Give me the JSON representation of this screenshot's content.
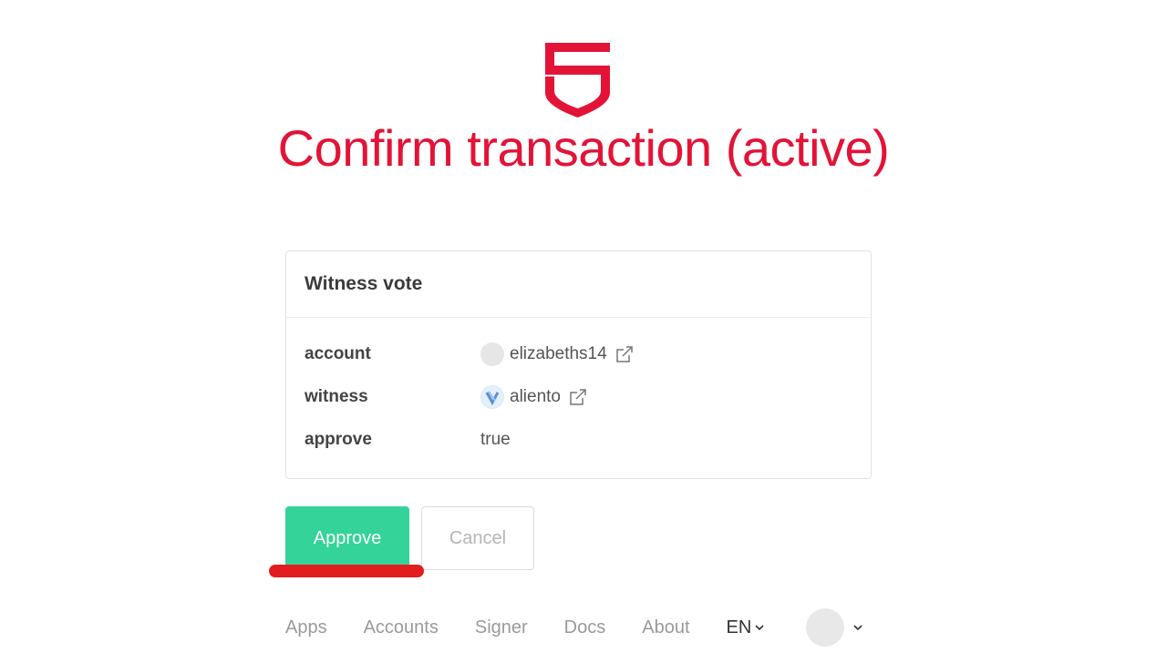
{
  "colors": {
    "brand": "#e31337",
    "approve": "#34d399",
    "underline": "#e11d1d"
  },
  "header": {
    "title": "Confirm transaction (active)",
    "logo_icon": "shield-five-logo"
  },
  "operation": {
    "title": "Witness vote",
    "rows": [
      {
        "label": "account",
        "value": "elizabeths14",
        "avatar": true,
        "link_icon": "external-link-icon"
      },
      {
        "label": "witness",
        "value": "aliento",
        "avatar": true,
        "link_icon": "external-link-icon"
      },
      {
        "label": "approve",
        "value": "true"
      }
    ]
  },
  "actions": {
    "approve_label": "Approve",
    "cancel_label": "Cancel"
  },
  "footer": {
    "links": [
      "Apps",
      "Accounts",
      "Signer",
      "Docs",
      "About"
    ],
    "language": "EN",
    "chevron_icon": "chevron-down-icon"
  }
}
